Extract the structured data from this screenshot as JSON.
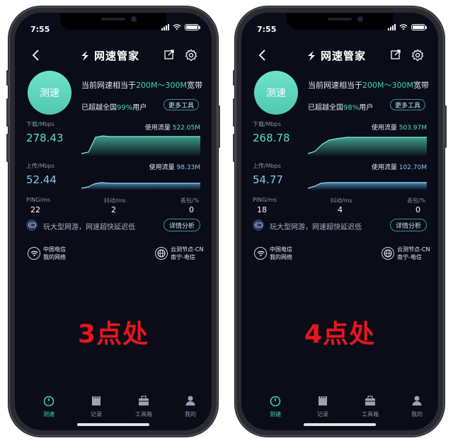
{
  "status": {
    "time": "7:55"
  },
  "app": {
    "title": "网速管家",
    "speed_button": "测速",
    "more_tools": "更多工具",
    "details": "详情分析",
    "labels": {
      "download": "下载/Mbps",
      "upload": "上传/Mbps",
      "usage_prefix": "使用流量",
      "ping": "PING/ms",
      "jitter": "抖动/ms",
      "loss": "丢包/%"
    },
    "equiv_pre": "当前网速相当于",
    "equiv_val": "200M～300M",
    "equiv_post": "宽带",
    "beat_pre": "已超越全国",
    "beat_post": "用户",
    "game_text": "玩大型网游，网速超快延迟低",
    "tabs": [
      "测速",
      "记录",
      "工具箱",
      "我的"
    ]
  },
  "colors": {
    "accent": "#3ed7c0",
    "download": "#5fdcc4",
    "upload": "#7fcaf4",
    "label_red": "#e8161a",
    "screen_bg": "#0a0d18"
  },
  "icons": [
    "back-icon",
    "logo-icon",
    "share-icon",
    "gear-icon",
    "gamepad-icon",
    "wifi-icon",
    "globe-icon",
    "speed-tab-icon",
    "record-tab-icon",
    "toolbox-tab-icon",
    "profile-tab-icon"
  ],
  "phones": [
    {
      "beat_pct": "99%",
      "download": "278.43",
      "download_usage": "522.05M",
      "upload": "52.44",
      "upload_usage": "98.33M",
      "ping": "22",
      "jitter": "2",
      "loss": "0",
      "isp": "中国电信",
      "my_network": "我的网络",
      "node": "云测节点-CN",
      "node_location": "南宁-电信",
      "caption": "3点处"
    },
    {
      "beat_pct": "98%",
      "download": "268.78",
      "download_usage": "503.97M",
      "upload": "54.77",
      "upload_usage": "102.70M",
      "ping": "18",
      "jitter": "4",
      "loss": "0",
      "isp": "中国电信",
      "my_network": "我的网络",
      "node": "云测节点-CN",
      "node_location": "南宁-电信",
      "caption": "4点处"
    }
  ]
}
